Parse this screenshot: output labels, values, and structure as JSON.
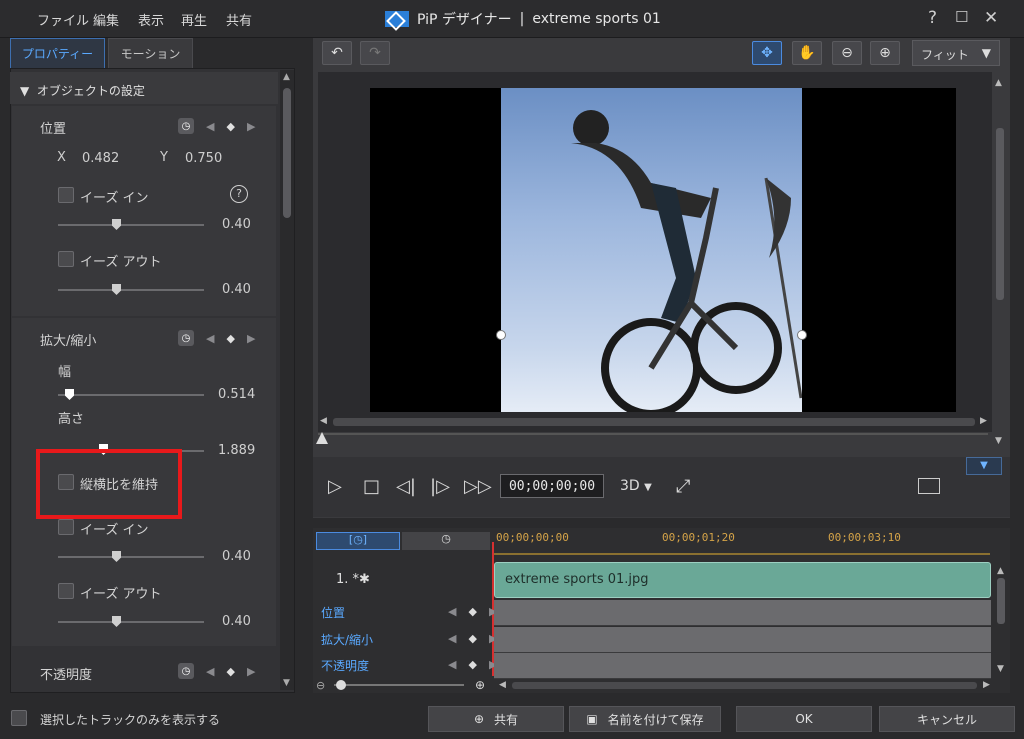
{
  "menu": [
    "ファイル",
    "編集",
    "表示",
    "再生",
    "共有"
  ],
  "window": {
    "app_name": "PiP デザイナー",
    "separator": "|",
    "document": "extreme sports 01",
    "help": "?",
    "maximize": "☐",
    "close": "✕"
  },
  "tabs": {
    "properties": "プロパティー",
    "motion": "モーション"
  },
  "object_settings": {
    "header": "オブジェクトの設定"
  },
  "position": {
    "label": "位置",
    "x_label": "X",
    "x_value": "0.482",
    "y_label": "Y",
    "y_value": "0.750",
    "ease_in_label": "イーズ イン",
    "ease_in_value": "0.40",
    "ease_in_level": 0.4,
    "ease_out_label": "イーズ アウト",
    "ease_out_value": "0.40",
    "ease_out_level": 0.4,
    "help": "?"
  },
  "scale": {
    "label": "拡大/縮小",
    "width_label": "幅",
    "width_value": "0.514",
    "height_label": "高さ",
    "height_value": "1.889",
    "keep_aspect_label": "縦横比を維持",
    "ease_in_label": "イーズ イン",
    "ease_in_value": "0.40",
    "ease_out_label": "イーズ アウト",
    "ease_out_value": "0.40"
  },
  "opacity": {
    "label": "不透明度"
  },
  "preview": {
    "fit_label": "フィット",
    "timecode": "00;00;00;00",
    "mode_3d": "3D"
  },
  "timeline": {
    "ruler": [
      "00;00;00;00",
      "00;00;01;20",
      "00;00;03;10"
    ],
    "track_name": "1. *",
    "clip_name": "extreme sports 01.jpg",
    "rows": [
      "位置",
      "拡大/縮小",
      "不透明度"
    ]
  },
  "footer": {
    "show_selected_only": "選択したトラックのみを表示する",
    "share": "共有",
    "save_as": "名前を付けて保存",
    "ok": "OK",
    "cancel": "キャンセル"
  },
  "colors": {
    "accent": "#5aa9ff",
    "highlight_box": "#e8191b",
    "clip": "#6aa897",
    "ruler_text": "#d4a348"
  }
}
